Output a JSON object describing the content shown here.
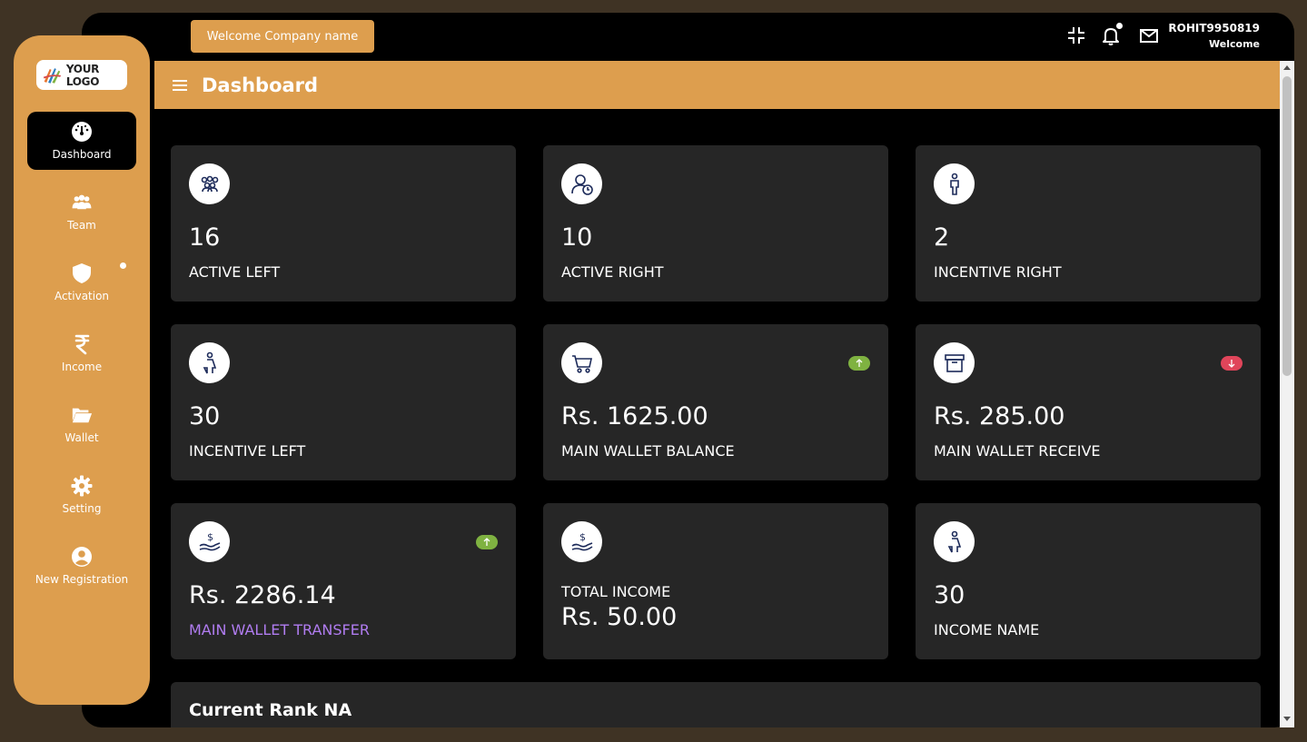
{
  "logo": {
    "text": "YOUR LOGO"
  },
  "sidebar": {
    "items": [
      {
        "label": "Dashboard",
        "icon": "dashboard-gauge-icon",
        "active": true
      },
      {
        "label": "Team",
        "icon": "team-icon"
      },
      {
        "label": "Activation",
        "icon": "shield-icon"
      },
      {
        "label": "Income",
        "icon": "rupee-icon"
      },
      {
        "label": "Wallet",
        "icon": "folder-open-icon"
      },
      {
        "label": "Setting",
        "icon": "gear-icon"
      },
      {
        "label": "New Registration",
        "icon": "user-circle-icon"
      }
    ]
  },
  "topbar": {
    "welcome_button": "Welcome Company name",
    "user_name": "ROHIT9950819",
    "user_sub": "Welcome",
    "icons": [
      "compress-icon",
      "bell-icon",
      "mail-icon"
    ]
  },
  "header": {
    "title": "Dashboard"
  },
  "cards": [
    {
      "value": "16",
      "label": "ACTIVE LEFT",
      "icon": "group-icon"
    },
    {
      "value": "10",
      "label": "ACTIVE RIGHT",
      "icon": "user-clock-icon"
    },
    {
      "value": "2",
      "label": "INCENTIVE RIGHT",
      "icon": "man-icon"
    },
    {
      "value": "30",
      "label": "INCENTIVE LEFT",
      "icon": "woman-icon"
    },
    {
      "value": "Rs. 1625.00",
      "label": "MAIN WALLET BALANCE",
      "icon": "cart-icon",
      "badge": "up"
    },
    {
      "value": "Rs. 285.00",
      "label": "MAIN WALLET RECEIVE",
      "icon": "box-icon",
      "badge": "down"
    },
    {
      "value": "Rs. 2286.14",
      "label": "MAIN WALLET TRANSFER",
      "icon": "money-hand-icon",
      "badge": "up"
    },
    {
      "value": "Rs. 50.00",
      "label": "TOTAL INCOME",
      "icon": "money-hand-icon"
    },
    {
      "value": "30",
      "label": "INCOME NAME",
      "icon": "woman-icon"
    }
  ],
  "rank": {
    "title": "Current Rank NA",
    "subtitle": ""
  },
  "colors": {
    "accent": "#dd9e4e",
    "card": "#262626",
    "badge_up": "#7fb241",
    "badge_down": "#e0455a",
    "purple_label": "#b07cf0"
  }
}
